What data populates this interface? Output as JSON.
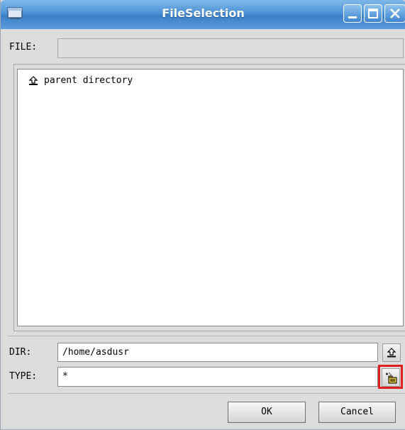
{
  "window": {
    "title": "FileSelection",
    "title_color": "#4d93d6"
  },
  "file": {
    "label": "FILE:",
    "value": ""
  },
  "list": {
    "items": [
      {
        "icon": "up-arrow-icon",
        "label": "parent directory"
      }
    ]
  },
  "dir": {
    "label": "DIR:",
    "value": "/home/asdusr",
    "button_icon": "parent-directory-icon"
  },
  "type": {
    "label": "TYPE:",
    "value": "*",
    "button_icon": "new-folder-icon",
    "highlight_color": "#e02020"
  },
  "buttons": {
    "ok": "OK",
    "cancel": "Cancel"
  }
}
